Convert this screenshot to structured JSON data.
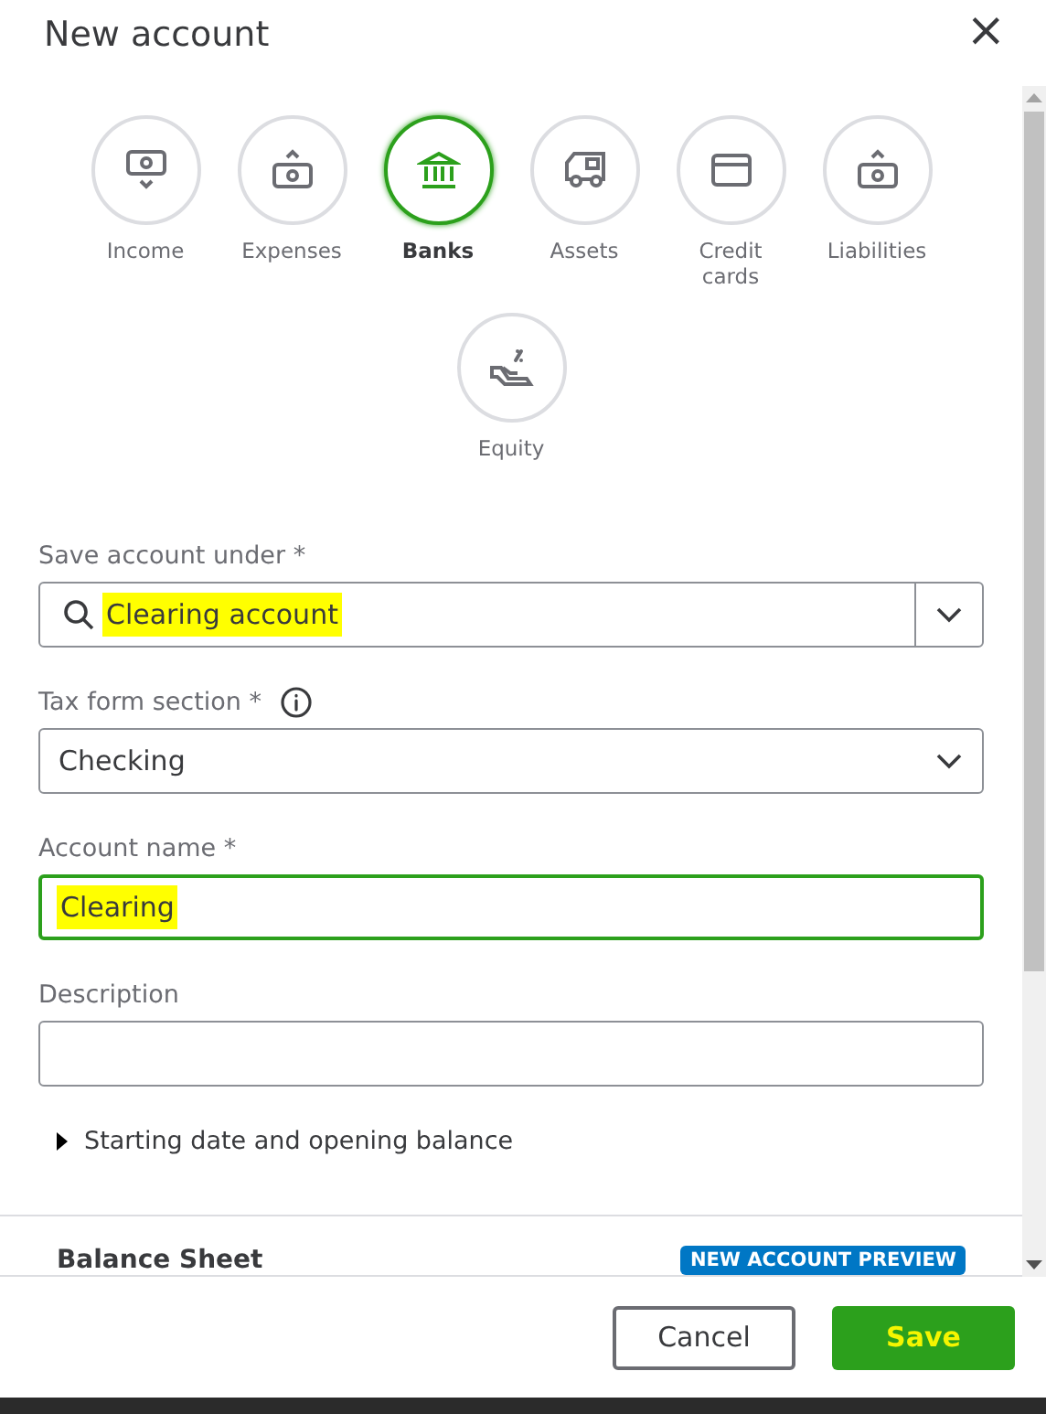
{
  "window": {
    "title": "New account",
    "close": "×"
  },
  "categories": [
    {
      "label": "Income",
      "kind": "cashdown",
      "selected": false
    },
    {
      "label": "Expenses",
      "kind": "cashup",
      "selected": false
    },
    {
      "label": "Banks",
      "kind": "bank",
      "selected": true
    },
    {
      "label": "Assets",
      "kind": "van",
      "selected": false
    },
    {
      "label": "Credit cards",
      "kind": "card",
      "selected": false
    },
    {
      "label": "Liabilities",
      "kind": "cashup",
      "selected": false
    },
    {
      "label": "Equity",
      "kind": "hand",
      "selected": false
    }
  ],
  "fields": [
    {
      "kind": "search-select",
      "label": "Save account under *",
      "value": "Clearing account",
      "highlighted": true,
      "focused": false,
      "info": false
    },
    {
      "kind": "select",
      "label": "Tax form section *",
      "value": "Checking",
      "highlighted": false,
      "focused": false,
      "info": true
    },
    {
      "kind": "text",
      "label": "Account name *",
      "value": "Clearing",
      "highlighted": true,
      "focused": true,
      "info": false
    },
    {
      "kind": "text",
      "label": "Description",
      "focused": false,
      "info": false
    }
  ],
  "section": {
    "label": "Starting date and opening balance",
    "expanded": false
  },
  "preview": {
    "title": "Balance Sheet",
    "badge": "NEW ACCOUNT PREVIEW"
  },
  "buttons": [
    {
      "label": "Cancel",
      "kind": "secondary",
      "highlighted": false
    },
    {
      "label": "Save",
      "kind": "primary",
      "highlighted": true
    }
  ]
}
